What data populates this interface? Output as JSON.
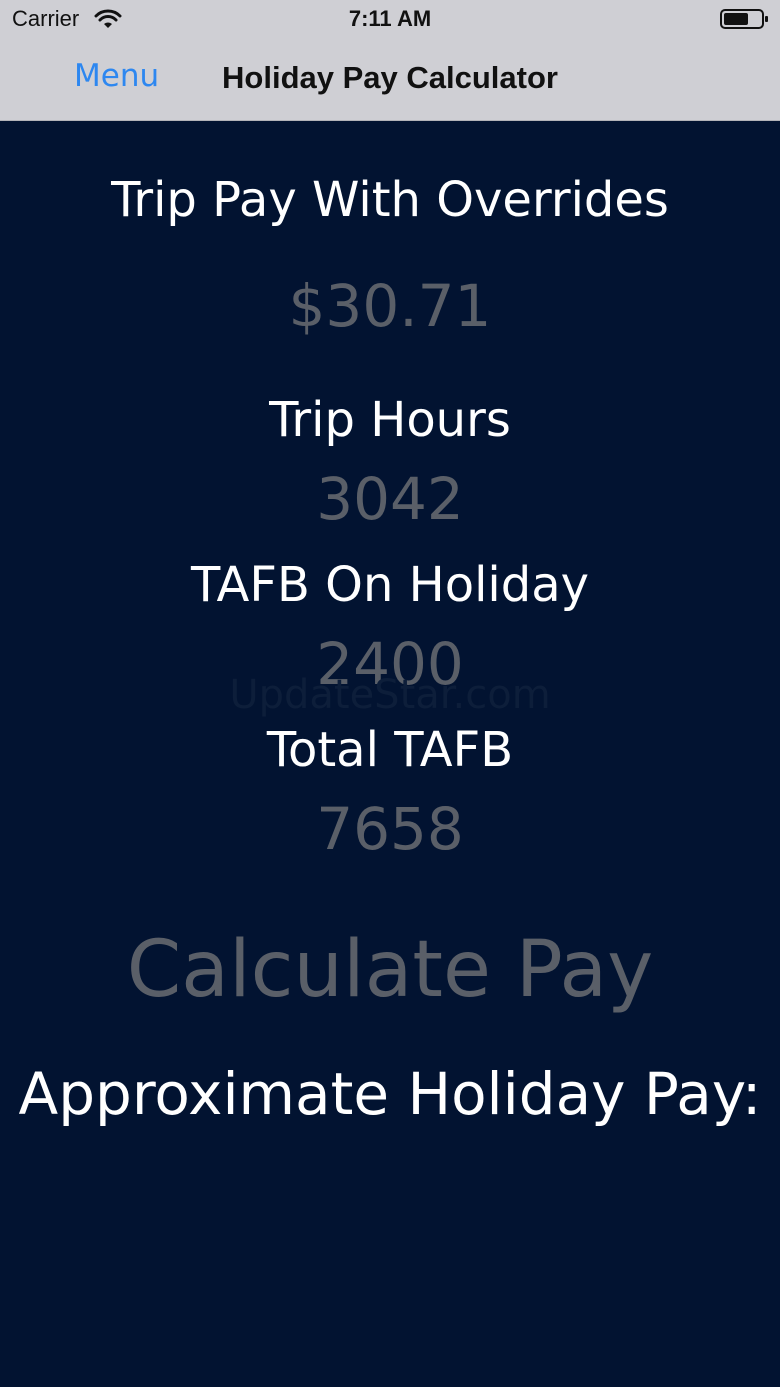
{
  "status_bar": {
    "carrier": "Carrier",
    "time": "7:11 AM",
    "wifi_icon": "wifi-icon",
    "battery_icon": "battery-icon"
  },
  "nav": {
    "menu_label": "Menu",
    "title": "Holiday Pay Calculator"
  },
  "fields": {
    "trip_pay": {
      "label": "Trip Pay With Overrides",
      "value": "$30.71"
    },
    "trip_hours": {
      "label": "Trip Hours",
      "value": "3042"
    },
    "tafb_on_holiday": {
      "label": "TAFB On Holiday",
      "value": "2400"
    },
    "total_tafb": {
      "label": "Total TAFB",
      "value": "7658"
    }
  },
  "watermark": "UpdateStar.com",
  "calculate_label": "Calculate Pay",
  "result_label": "Approximate Holiday Pay:",
  "colors": {
    "background": "#021331",
    "nav_background": "#cfcfd4",
    "accent": "#2d87f0",
    "value_text": "#5a5f68",
    "label_text": "#ffffff"
  }
}
